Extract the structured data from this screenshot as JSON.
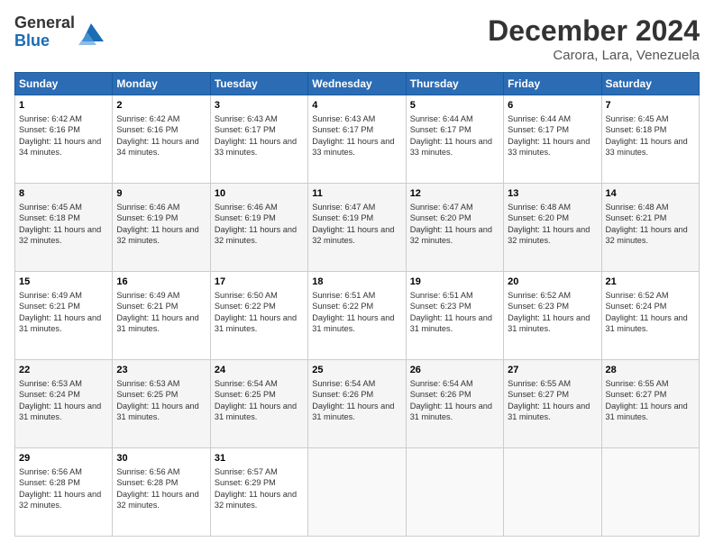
{
  "header": {
    "logo_line1": "General",
    "logo_line2": "Blue",
    "month": "December 2024",
    "location": "Carora, Lara, Venezuela"
  },
  "days_of_week": [
    "Sunday",
    "Monday",
    "Tuesday",
    "Wednesday",
    "Thursday",
    "Friday",
    "Saturday"
  ],
  "weeks": [
    [
      {
        "day": 1,
        "sr": "6:42 AM",
        "ss": "6:16 PM",
        "dl": "11 hours and 34 minutes."
      },
      {
        "day": 2,
        "sr": "6:42 AM",
        "ss": "6:16 PM",
        "dl": "11 hours and 34 minutes."
      },
      {
        "day": 3,
        "sr": "6:43 AM",
        "ss": "6:17 PM",
        "dl": "11 hours and 33 minutes."
      },
      {
        "day": 4,
        "sr": "6:43 AM",
        "ss": "6:17 PM",
        "dl": "11 hours and 33 minutes."
      },
      {
        "day": 5,
        "sr": "6:44 AM",
        "ss": "6:17 PM",
        "dl": "11 hours and 33 minutes."
      },
      {
        "day": 6,
        "sr": "6:44 AM",
        "ss": "6:17 PM",
        "dl": "11 hours and 33 minutes."
      },
      {
        "day": 7,
        "sr": "6:45 AM",
        "ss": "6:18 PM",
        "dl": "11 hours and 33 minutes."
      }
    ],
    [
      {
        "day": 8,
        "sr": "6:45 AM",
        "ss": "6:18 PM",
        "dl": "11 hours and 32 minutes."
      },
      {
        "day": 9,
        "sr": "6:46 AM",
        "ss": "6:19 PM",
        "dl": "11 hours and 32 minutes."
      },
      {
        "day": 10,
        "sr": "6:46 AM",
        "ss": "6:19 PM",
        "dl": "11 hours and 32 minutes."
      },
      {
        "day": 11,
        "sr": "6:47 AM",
        "ss": "6:19 PM",
        "dl": "11 hours and 32 minutes."
      },
      {
        "day": 12,
        "sr": "6:47 AM",
        "ss": "6:20 PM",
        "dl": "11 hours and 32 minutes."
      },
      {
        "day": 13,
        "sr": "6:48 AM",
        "ss": "6:20 PM",
        "dl": "11 hours and 32 minutes."
      },
      {
        "day": 14,
        "sr": "6:48 AM",
        "ss": "6:21 PM",
        "dl": "11 hours and 32 minutes."
      }
    ],
    [
      {
        "day": 15,
        "sr": "6:49 AM",
        "ss": "6:21 PM",
        "dl": "11 hours and 31 minutes."
      },
      {
        "day": 16,
        "sr": "6:49 AM",
        "ss": "6:21 PM",
        "dl": "11 hours and 31 minutes."
      },
      {
        "day": 17,
        "sr": "6:50 AM",
        "ss": "6:22 PM",
        "dl": "11 hours and 31 minutes."
      },
      {
        "day": 18,
        "sr": "6:51 AM",
        "ss": "6:22 PM",
        "dl": "11 hours and 31 minutes."
      },
      {
        "day": 19,
        "sr": "6:51 AM",
        "ss": "6:23 PM",
        "dl": "11 hours and 31 minutes."
      },
      {
        "day": 20,
        "sr": "6:52 AM",
        "ss": "6:23 PM",
        "dl": "11 hours and 31 minutes."
      },
      {
        "day": 21,
        "sr": "6:52 AM",
        "ss": "6:24 PM",
        "dl": "11 hours and 31 minutes."
      }
    ],
    [
      {
        "day": 22,
        "sr": "6:53 AM",
        "ss": "6:24 PM",
        "dl": "11 hours and 31 minutes."
      },
      {
        "day": 23,
        "sr": "6:53 AM",
        "ss": "6:25 PM",
        "dl": "11 hours and 31 minutes."
      },
      {
        "day": 24,
        "sr": "6:54 AM",
        "ss": "6:25 PM",
        "dl": "11 hours and 31 minutes."
      },
      {
        "day": 25,
        "sr": "6:54 AM",
        "ss": "6:26 PM",
        "dl": "11 hours and 31 minutes."
      },
      {
        "day": 26,
        "sr": "6:54 AM",
        "ss": "6:26 PM",
        "dl": "11 hours and 31 minutes."
      },
      {
        "day": 27,
        "sr": "6:55 AM",
        "ss": "6:27 PM",
        "dl": "11 hours and 31 minutes."
      },
      {
        "day": 28,
        "sr": "6:55 AM",
        "ss": "6:27 PM",
        "dl": "11 hours and 31 minutes."
      }
    ],
    [
      {
        "day": 29,
        "sr": "6:56 AM",
        "ss": "6:28 PM",
        "dl": "11 hours and 32 minutes."
      },
      {
        "day": 30,
        "sr": "6:56 AM",
        "ss": "6:28 PM",
        "dl": "11 hours and 32 minutes."
      },
      {
        "day": 31,
        "sr": "6:57 AM",
        "ss": "6:29 PM",
        "dl": "11 hours and 32 minutes."
      },
      null,
      null,
      null,
      null
    ]
  ]
}
